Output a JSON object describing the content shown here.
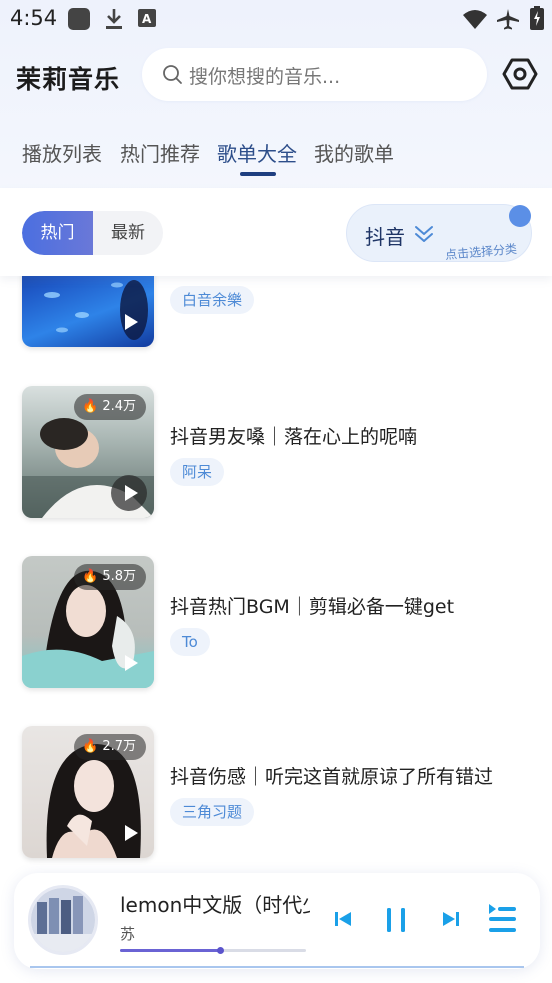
{
  "status_bar": {
    "time": "4:54",
    "icons": [
      "square-icon",
      "download-icon",
      "a-icon",
      "wifi-icon",
      "airplane-icon",
      "battery-charging-icon"
    ]
  },
  "header": {
    "app_title": "茉莉音乐",
    "search_placeholder": "搜你想搜的音乐...",
    "settings_icon": "hexagon-settings-icon"
  },
  "tabs": [
    {
      "label": "播放列表",
      "active": false
    },
    {
      "label": "热门推荐",
      "active": false
    },
    {
      "label": "歌单大全",
      "active": true
    },
    {
      "label": "我的歌单",
      "active": false
    }
  ],
  "filter": {
    "hot_label": "热门",
    "new_label": "最新",
    "category_label": "抖音",
    "category_hint": "点击选择分类"
  },
  "playlists": [
    {
      "title": "",
      "author": "白音余樂",
      "plays": ""
    },
    {
      "title": "抖音男友嗓｜落在心上的呢喃",
      "author": "阿呆",
      "plays": "2.4万"
    },
    {
      "title": "抖音热门BGM｜剪辑必备一键get",
      "author": "To",
      "plays": "5.8万"
    },
    {
      "title": "抖音伤感｜听完这首就原谅了所有错过",
      "author": "三角习题",
      "plays": "2.7万"
    }
  ],
  "player": {
    "song_title": "lemon中文版（时代少年团）",
    "artist": "苏",
    "progress": 0.54
  },
  "colors": {
    "accent": "#4b6fe0",
    "control_blue": "#1aa0e8",
    "tag_text": "#4d8ad6",
    "tag_bg": "#eef3fb"
  }
}
